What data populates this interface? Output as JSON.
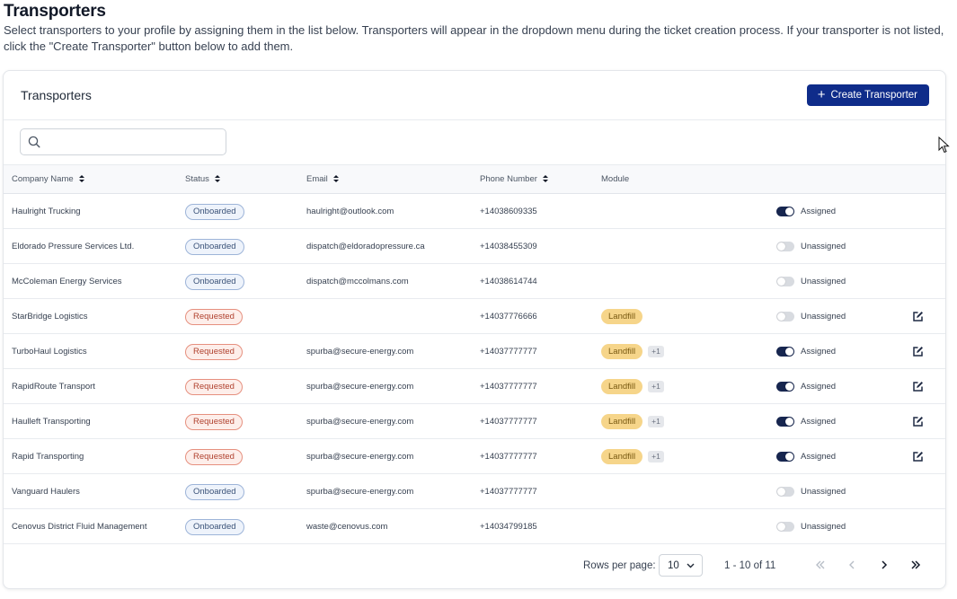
{
  "page": {
    "title": "Transporters",
    "intro": "Select transporters to your profile by assigning them in the list below. Transporters will appear in the dropdown menu during the ticket creation process. If your transporter is not listed, click the \"Create Transporter\" button below to add them."
  },
  "card": {
    "title": "Transporters",
    "create_label": "Create Transporter",
    "search": {
      "value": "",
      "placeholder": ""
    }
  },
  "columns": {
    "company": "Company Name",
    "status": "Status",
    "email": "Email",
    "phone": "Phone Number",
    "module": "Module"
  },
  "rows": [
    {
      "company": "Haulright Trucking",
      "status": "Onboarded",
      "email": "haulright@outlook.com",
      "phone": "+14038609335",
      "module": "",
      "more": "",
      "assigned": true,
      "assign_label": "Assigned",
      "editable": false
    },
    {
      "company": "Eldorado Pressure Services Ltd.",
      "status": "Onboarded",
      "email": "dispatch@eldoradopressure.ca",
      "phone": "+14038455309",
      "module": "",
      "more": "",
      "assigned": false,
      "assign_label": "Unassigned",
      "editable": false
    },
    {
      "company": "McColeman Energy Services",
      "status": "Onboarded",
      "email": "dispatch@mccolmans.com",
      "phone": "+14038614744",
      "module": "",
      "more": "",
      "assigned": false,
      "assign_label": "Unassigned",
      "editable": false
    },
    {
      "company": "StarBridge Logistics",
      "status": "Requested",
      "email": "",
      "phone": "+14037776666",
      "module": "Landfill",
      "more": "",
      "assigned": false,
      "assign_label": "Unassigned",
      "editable": true
    },
    {
      "company": "TurboHaul Logistics",
      "status": "Requested",
      "email": "spurba@secure-energy.com",
      "phone": "+14037777777",
      "module": "Landfill",
      "more": "+1",
      "assigned": true,
      "assign_label": "Assigned",
      "editable": true
    },
    {
      "company": "RapidRoute Transport",
      "status": "Requested",
      "email": "spurba@secure-energy.com",
      "phone": "+14037777777",
      "module": "Landfill",
      "more": "+1",
      "assigned": true,
      "assign_label": "Assigned",
      "editable": true
    },
    {
      "company": "Haulleft Transporting",
      "status": "Requested",
      "email": "spurba@secure-energy.com",
      "phone": "+14037777777",
      "module": "Landfill",
      "more": "+1",
      "assigned": true,
      "assign_label": "Assigned",
      "editable": true
    },
    {
      "company": "Rapid Transporting",
      "status": "Requested",
      "email": "spurba@secure-energy.com",
      "phone": "+14037777777",
      "module": "Landfill",
      "more": "+1",
      "assigned": true,
      "assign_label": "Assigned",
      "editable": true
    },
    {
      "company": "Vanguard Haulers",
      "status": "Onboarded",
      "email": "spurba@secure-energy.com",
      "phone": "+14037777777",
      "module": "",
      "more": "",
      "assigned": false,
      "assign_label": "Unassigned",
      "editable": false
    },
    {
      "company": "Cenovus District Fluid Management",
      "status": "Onboarded",
      "email": "waste@cenovus.com",
      "phone": "+14034799185",
      "module": "",
      "more": "",
      "assigned": false,
      "assign_label": "Unassigned",
      "editable": false
    }
  ],
  "pagination": {
    "rows_per_page_label": "Rows per page:",
    "rows_per_page": "10",
    "range": "1 - 10 of 11"
  },
  "colors": {
    "primary": "#0f2c8a",
    "toggle_on": "#17264f",
    "onboarded_bg": "#eef3fb",
    "requested_bg": "#fdeeea",
    "landfill_bg": "#f6d58a"
  }
}
